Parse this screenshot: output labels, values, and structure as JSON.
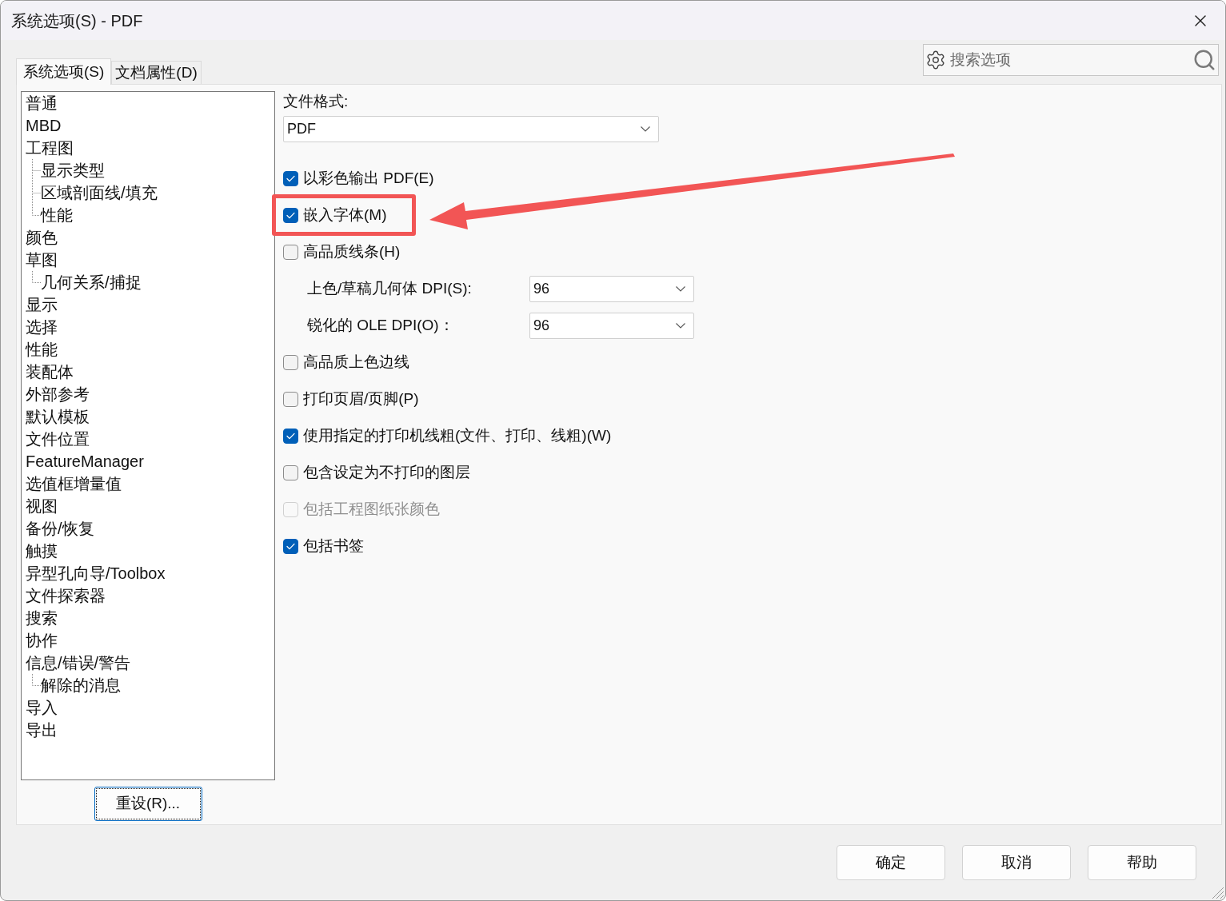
{
  "window": {
    "title": "系统选项(S) - PDF"
  },
  "tabs": [
    {
      "label": "系统选项(S)",
      "selected": true
    },
    {
      "label": "文档属性(D)",
      "selected": false
    }
  ],
  "search": {
    "placeholder": "搜索选项"
  },
  "sidebar": {
    "items": [
      {
        "label": "普通"
      },
      {
        "label": "MBD"
      },
      {
        "label": "工程图",
        "children": [
          {
            "label": "显示类型"
          },
          {
            "label": "区域剖面线/填充"
          },
          {
            "label": "性能"
          }
        ]
      },
      {
        "label": "颜色"
      },
      {
        "label": "草图",
        "children": [
          {
            "label": "几何关系/捕捉"
          }
        ]
      },
      {
        "label": "显示"
      },
      {
        "label": "选择"
      },
      {
        "label": "性能"
      },
      {
        "label": "装配体"
      },
      {
        "label": "外部参考"
      },
      {
        "label": "默认模板"
      },
      {
        "label": "文件位置"
      },
      {
        "label": "FeatureManager"
      },
      {
        "label": "选值框增量值"
      },
      {
        "label": "视图"
      },
      {
        "label": "备份/恢复"
      },
      {
        "label": "触摸"
      },
      {
        "label": "异型孔向导/Toolbox"
      },
      {
        "label": "文件探索器"
      },
      {
        "label": "搜索"
      },
      {
        "label": "协作"
      },
      {
        "label": "信息/错误/警告",
        "children": [
          {
            "label": "解除的消息"
          }
        ]
      },
      {
        "label": "导入"
      },
      {
        "label": "导出"
      }
    ]
  },
  "reset_button": {
    "label": "重设(R)...",
    "focused": true
  },
  "content": {
    "file_format": {
      "label": "文件格式:",
      "value": "PDF"
    },
    "options": [
      {
        "kind": "checkbox",
        "label": "以彩色输出 PDF(E)",
        "checked": true,
        "disabled": false,
        "annotated": false
      },
      {
        "kind": "checkbox",
        "label": "嵌入字体(M)",
        "checked": true,
        "disabled": false,
        "annotated": true
      },
      {
        "kind": "checkbox",
        "label": "高品质线条(H)",
        "checked": false,
        "disabled": false,
        "annotated": false
      },
      {
        "kind": "dropdown",
        "label": "上色/草稿几何体 DPI(S):",
        "value": "96",
        "disabled": false,
        "annotated": false
      },
      {
        "kind": "dropdown",
        "label": "锐化的 OLE DPI(O)：",
        "value": "96",
        "disabled": false,
        "annotated": false
      },
      {
        "kind": "checkbox",
        "label": "高品质上色边线",
        "checked": false,
        "disabled": false,
        "annotated": false
      },
      {
        "kind": "checkbox",
        "label": "打印页眉/页脚(P)",
        "checked": false,
        "disabled": false,
        "annotated": false
      },
      {
        "kind": "checkbox",
        "label": "使用指定的打印机线粗(文件、打印、线粗)(W)",
        "checked": true,
        "disabled": false,
        "annotated": false
      },
      {
        "kind": "checkbox",
        "label": "包含设定为不打印的图层",
        "checked": false,
        "disabled": false,
        "annotated": false
      },
      {
        "kind": "checkbox",
        "label": "包括工程图纸张颜色",
        "checked": false,
        "disabled": true,
        "annotated": false
      },
      {
        "kind": "checkbox",
        "label": "包括书签",
        "checked": true,
        "disabled": false,
        "annotated": false
      }
    ]
  },
  "buttons": [
    {
      "label": "确定"
    },
    {
      "label": "取消"
    },
    {
      "label": "帮助"
    }
  ]
}
